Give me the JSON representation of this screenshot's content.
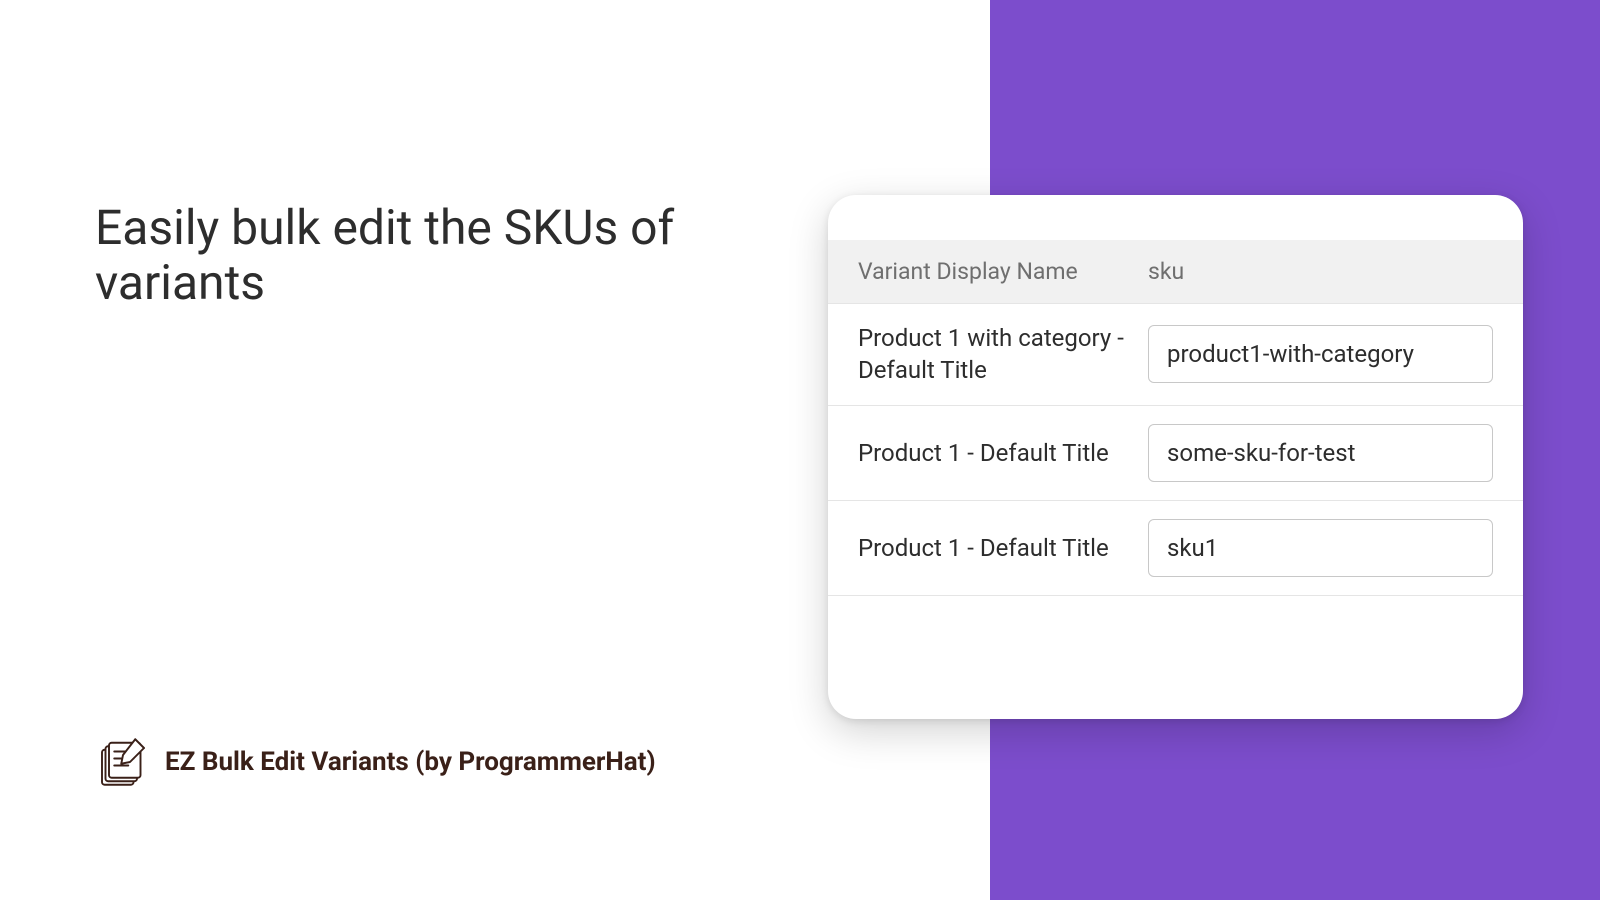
{
  "headline": "Easily bulk edit the SKUs of variants",
  "brand": {
    "name": "EZ Bulk Edit Variants (by ProgrammerHat)"
  },
  "table": {
    "headers": {
      "name": "Variant Display Name",
      "sku": "sku"
    },
    "rows": [
      {
        "name": "Product 1 with category - Default Title",
        "sku": "product1-with-category"
      },
      {
        "name": "Product 1 - Default Title",
        "sku": "some-sku-for-test"
      },
      {
        "name": "Product 1 - Default Title",
        "sku": "sku1"
      }
    ]
  },
  "colors": {
    "accent": "#7c4dcc",
    "brandText": "#3a2018"
  }
}
